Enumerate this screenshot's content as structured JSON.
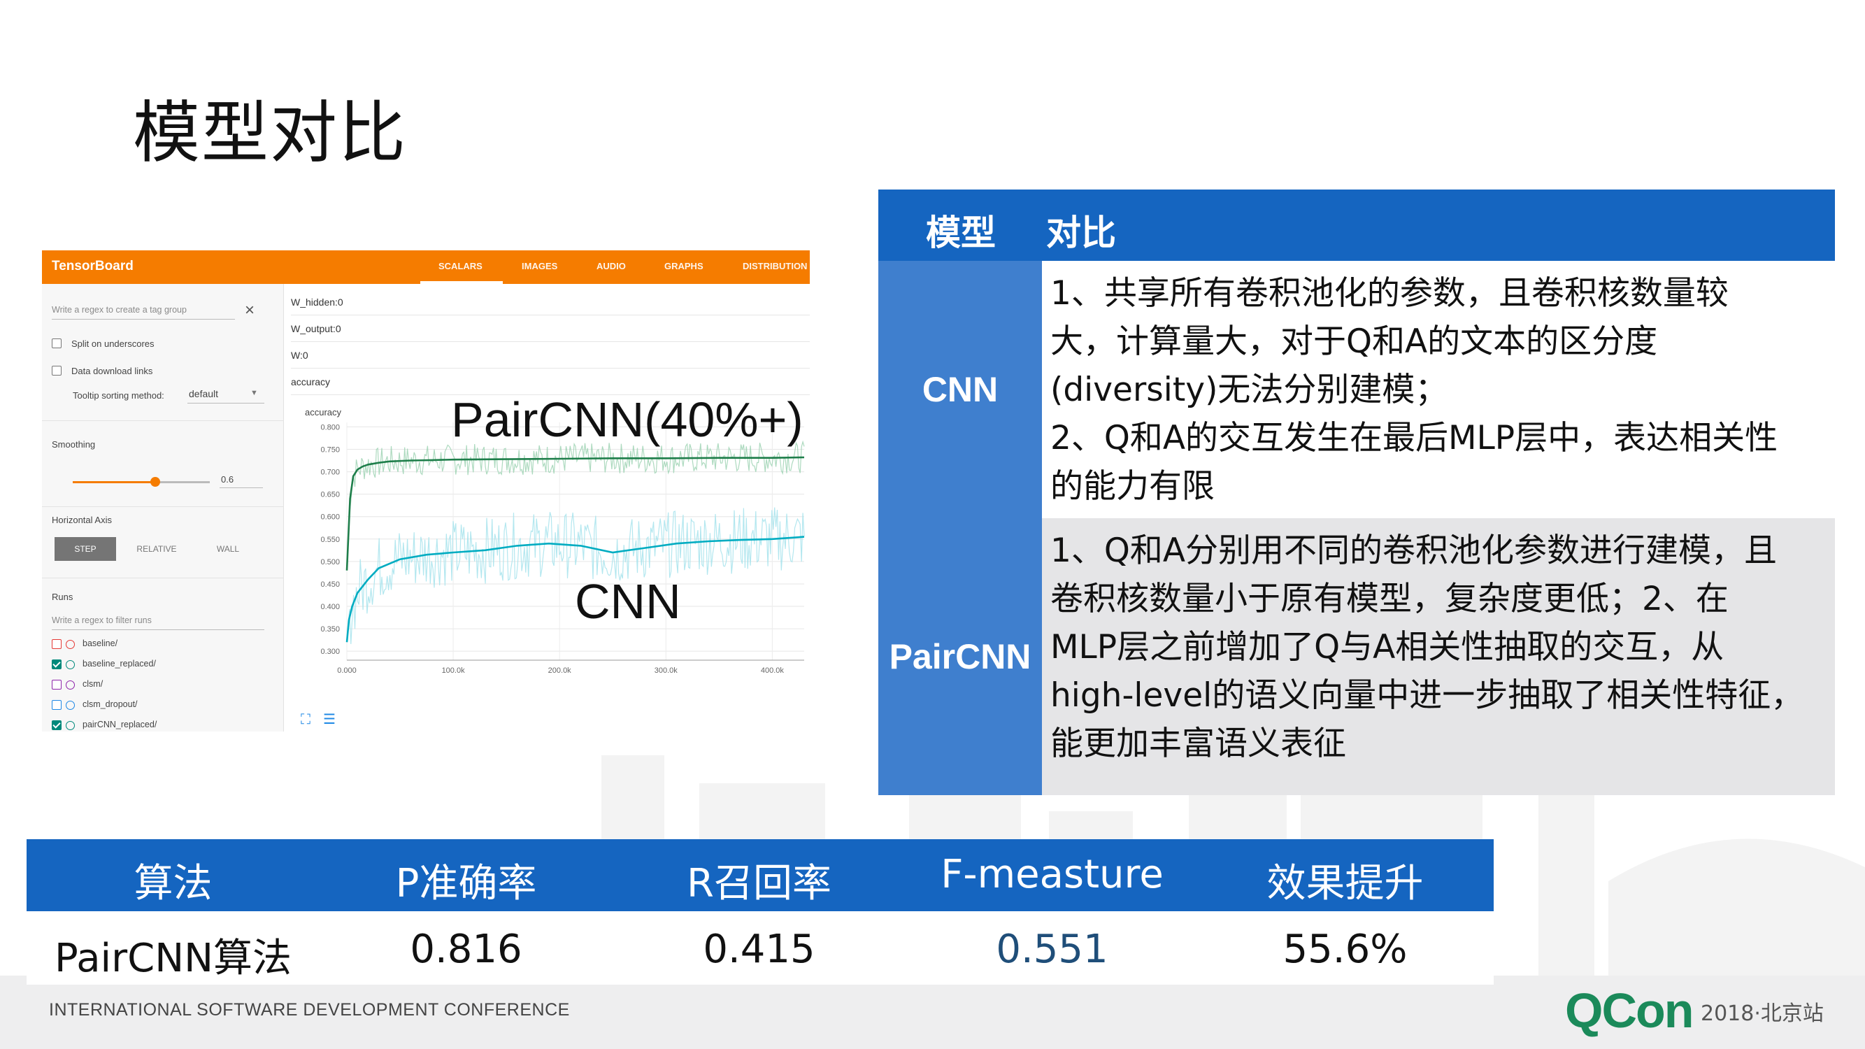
{
  "slide": {
    "title": "模型对比",
    "footer": "INTERNATIONAL SOFTWARE DEVELOPMENT CONFERENCE",
    "logo": "QCon",
    "logo_suffix": "2018·北京站"
  },
  "tensorboard": {
    "brand": "TensorBoard",
    "tabs": [
      "SCALARS",
      "IMAGES",
      "AUDIO",
      "GRAPHS",
      "DISTRIBUTION"
    ],
    "active_tab": "SCALARS",
    "tag_group_placeholder": "Write a regex to create a tag group",
    "split_label": "Split on underscores",
    "download_label": "Data download links",
    "tooltip_label": "Tooltip sorting method:",
    "tooltip_value": "default",
    "smoothing_label": "Smoothing",
    "smoothing_value": "0.6",
    "smoothing_fraction": 0.6,
    "horizontal_axis_label": "Horizontal Axis",
    "axis_buttons": [
      "STEP",
      "RELATIVE",
      "WALL"
    ],
    "runs_label": "Runs",
    "runs_filter_placeholder": "Write a regex to filter runs",
    "runs": [
      {
        "name": "baseline/",
        "checked": false,
        "color": "#e53935"
      },
      {
        "name": "baseline_replaced/",
        "checked": true,
        "color": "#00897b"
      },
      {
        "name": "clsm/",
        "checked": false,
        "color": "#8e24aa"
      },
      {
        "name": "clsm_dropout/",
        "checked": false,
        "color": "#1e88e5"
      },
      {
        "name": "pairCNN_replaced/",
        "checked": true,
        "color": "#00897b"
      }
    ],
    "tag_rows": [
      "W_hidden:0",
      "W_output:0",
      "W:0",
      "accuracy"
    ],
    "chart_title": "accuracy"
  },
  "annotations": {
    "paircnn": "PairCNN(40%+)",
    "cnn": "CNN"
  },
  "chart_data": {
    "type": "line",
    "title": "accuracy",
    "xlabel": "",
    "ylabel": "",
    "x_ticks": [
      "0.000",
      "100.0k",
      "200.0k",
      "300.0k",
      "400.0k"
    ],
    "y_ticks": [
      "0.800",
      "0.750",
      "0.700",
      "0.650",
      "0.600",
      "0.550",
      "0.500",
      "0.450",
      "0.400",
      "0.350",
      "0.300"
    ],
    "xlim": [
      0,
      430000
    ],
    "ylim": [
      0.28,
      0.81
    ],
    "grid": true,
    "series": [
      {
        "name": "PairCNN",
        "color": "#1e7e4a",
        "raw_color": "#9fd4b4",
        "x": [
          0,
          3000,
          6000,
          10000,
          15000,
          20000,
          30000,
          40000,
          60000,
          80000,
          100000,
          150000,
          200000,
          250000,
          300000,
          350000,
          400000,
          430000
        ],
        "values": [
          0.48,
          0.64,
          0.69,
          0.705,
          0.712,
          0.716,
          0.72,
          0.723,
          0.725,
          0.726,
          0.727,
          0.728,
          0.729,
          0.73,
          0.73,
          0.731,
          0.731,
          0.732
        ]
      },
      {
        "name": "CNN",
        "color": "#00acc1",
        "raw_color": "#a6e3ec",
        "x": [
          0,
          2000,
          5000,
          10000,
          20000,
          30000,
          50000,
          75000,
          100000,
          130000,
          160000,
          190000,
          220000,
          250000,
          280000,
          310000,
          340000,
          370000,
          400000,
          430000
        ],
        "values": [
          0.32,
          0.37,
          0.4,
          0.43,
          0.46,
          0.485,
          0.505,
          0.515,
          0.52,
          0.525,
          0.535,
          0.54,
          0.535,
          0.52,
          0.53,
          0.54,
          0.545,
          0.548,
          0.55,
          0.555
        ]
      }
    ]
  },
  "comparison": {
    "head_model": "模型",
    "head_compare": "对比",
    "rows": [
      {
        "model": "CNN",
        "text": "1、共享所有卷积池化的参数，且卷积核数量较\n大，计算量大，对于Q和A的文本的区分度\n(diversity)无法分别建模；\n2、Q和A的交互发生在最后MLP层中，表达相关性\n的能力有限"
      },
      {
        "model": "PairCNN",
        "text": "1、Q和A分别用不同的卷积池化参数进行建模，且\n卷积核数量小于原有模型，复杂度更低；2、在\nMLP层之前增加了Q与A相关性抽取的交互，从\nhigh-level的语义向量中进一步抽取了相关性特征，\n能更加丰富语义表征"
      }
    ]
  },
  "metrics": {
    "headers": [
      "算法",
      "P准确率",
      "R召回率",
      "F-measture",
      "效果提升"
    ],
    "row": [
      "PairCNN算法",
      "0.816",
      "0.415",
      "0.551",
      "55.6%"
    ],
    "highlight_color": "#1f4e79"
  }
}
